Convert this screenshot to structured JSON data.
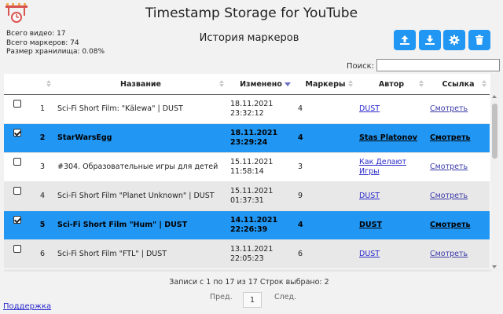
{
  "header": {
    "title": "Timestamp Storage for YouTube"
  },
  "stats": {
    "videos": "Всего видео: 17",
    "markers": "Всего маркеров: 74",
    "storage": "Размер хранилища: 0.08%"
  },
  "panel": {
    "title": "История маркеров"
  },
  "toolbar": {
    "export_icon": "upload-icon",
    "import_icon": "download-icon",
    "settings_icon": "gear-icon",
    "delete_icon": "trash-icon",
    "accent": "#2196f3"
  },
  "search": {
    "label": "Поиск:",
    "value": ""
  },
  "table": {
    "headers": {
      "name": "Название",
      "modified": "Изменено",
      "markers": "Маркеры",
      "author": "Автор",
      "link": "Ссылка"
    },
    "rows": [
      {
        "checked": false,
        "num": "1",
        "name": "Sci-Fi Short Film: \"Kälewa\" | DUST",
        "date": "18.11.2021",
        "time": "23:32:12",
        "markers": "4",
        "author": "DUST",
        "link": "Смотреть"
      },
      {
        "checked": true,
        "num": "2",
        "name": "StarWarsEgg",
        "date": "18.11.2021",
        "time": "23:29:24",
        "markers": "4",
        "author": "Stas Platonov",
        "link": "Смотреть"
      },
      {
        "checked": false,
        "num": "3",
        "name": "#304. Образовательные игры для детей",
        "date": "15.11.2021",
        "time": "11:58:14",
        "markers": "3",
        "author": "Как Делают Игры",
        "link": "Смотреть"
      },
      {
        "checked": false,
        "num": "4",
        "name": "Sci-Fi Short Film \"Planet Unknown\" | DUST",
        "date": "15.11.2021",
        "time": "01:37:31",
        "markers": "9",
        "author": "DUST",
        "link": "Смотреть"
      },
      {
        "checked": true,
        "num": "5",
        "name": "Sci-Fi Short Film \"Hum\" | DUST",
        "date": "14.11.2021",
        "time": "22:26:39",
        "markers": "4",
        "author": "DUST",
        "link": "Смотреть"
      },
      {
        "checked": false,
        "num": "6",
        "name": "Sci-Fi Short Film \"FTL\" | DUST",
        "date": "13.11.2021",
        "time": "22:05:23",
        "markers": "6",
        "author": "DUST",
        "link": "Смотреть"
      }
    ]
  },
  "footer": {
    "info": "Записи с 1 по 17 из 17   Строк выбрано: 2",
    "prev": "Пред.",
    "page": "1",
    "next": "След.",
    "support": "Поддержка"
  }
}
